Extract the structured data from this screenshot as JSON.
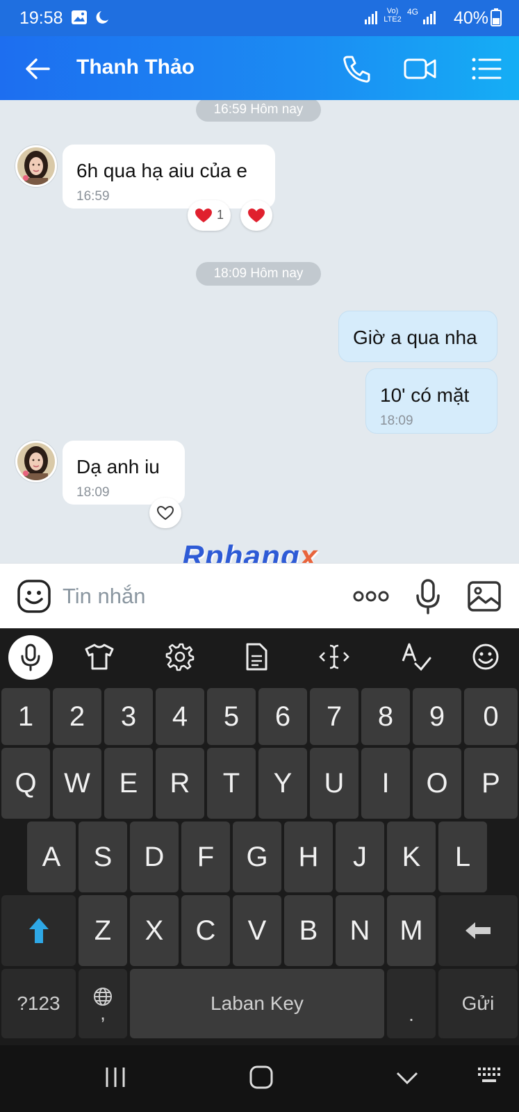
{
  "status_bar": {
    "time": "19:58",
    "battery": "40%",
    "lte_label": "Vo) LTE2",
    "net_label": "4G"
  },
  "header": {
    "contact_name": "Thanh Thảo",
    "icons": [
      "back-arrow-icon",
      "phone-icon",
      "video-call-icon",
      "menu-list-icon"
    ]
  },
  "chat": {
    "date_separators": [
      "16:59 Hôm nay",
      "18:09 Hôm nay"
    ],
    "messages": [
      {
        "direction": "incoming",
        "text": "6h qua hạ aiu của e",
        "time": "16:59",
        "reaction_count": "1"
      },
      {
        "direction": "outgoing",
        "text": "Giờ a qua nha",
        "time": ""
      },
      {
        "direction": "outgoing",
        "text": "10' có mặt",
        "time": "18:09"
      },
      {
        "direction": "incoming",
        "text": "Dạ anh iu",
        "time": "18:09"
      }
    ]
  },
  "watermark": {
    "main": "Rphang",
    "accent": "x"
  },
  "composer": {
    "placeholder": "Tin nhắn"
  },
  "keyboard": {
    "number_row": [
      "1",
      "2",
      "3",
      "4",
      "5",
      "6",
      "7",
      "8",
      "9",
      "0"
    ],
    "row1": [
      "Q",
      "W",
      "E",
      "R",
      "T",
      "Y",
      "U",
      "I",
      "O",
      "P"
    ],
    "row2": [
      "A",
      "S",
      "D",
      "F",
      "G",
      "H",
      "J",
      "K",
      "L"
    ],
    "row3": [
      "Z",
      "X",
      "C",
      "V",
      "B",
      "N",
      "M"
    ],
    "symbols_label": "?123",
    "comma_label": ",",
    "space_label": "Laban Key",
    "period_label": ".",
    "send_label": "Gửi"
  }
}
